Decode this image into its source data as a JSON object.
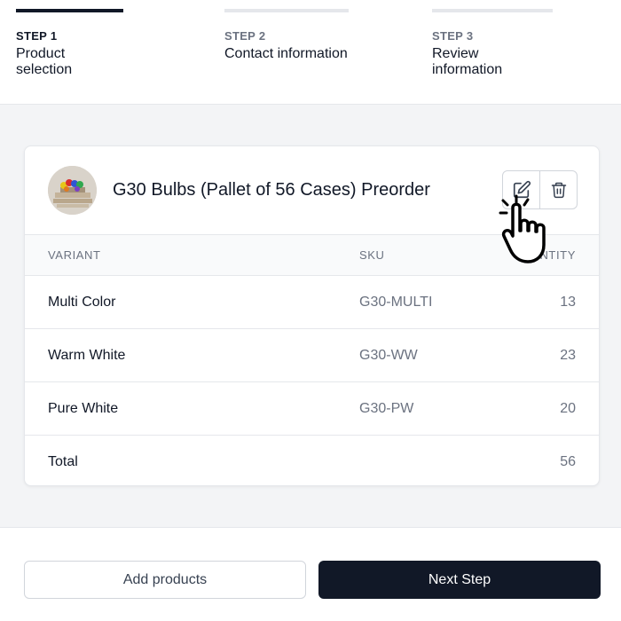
{
  "steps": [
    {
      "number": "STEP 1",
      "name": "Product selection",
      "active": true
    },
    {
      "number": "STEP 2",
      "name": "Contact information",
      "active": false
    },
    {
      "number": "STEP 3",
      "name": "Review information",
      "active": false
    }
  ],
  "product": {
    "title": "G30 Bulbs (Pallet of 56 Cases) Preorder",
    "edit_icon": "edit-icon",
    "delete_icon": "trash-icon"
  },
  "table": {
    "headers": {
      "variant": "VARIANT",
      "sku": "SKU",
      "quantity": "QUANTITY"
    },
    "rows": [
      {
        "variant": "Multi Color",
        "sku": "G30-MULTI",
        "quantity": "13"
      },
      {
        "variant": "Warm White",
        "sku": "G30-WW",
        "quantity": "23"
      },
      {
        "variant": "Pure White",
        "sku": "G30-PW",
        "quantity": "20"
      }
    ],
    "total": {
      "label": "Total",
      "quantity": "56"
    }
  },
  "footer": {
    "add_products": "Add products",
    "next_step": "Next Step"
  },
  "colors": {
    "primary": "#111827",
    "border": "#e5e7eb",
    "muted": "#6b7280"
  }
}
